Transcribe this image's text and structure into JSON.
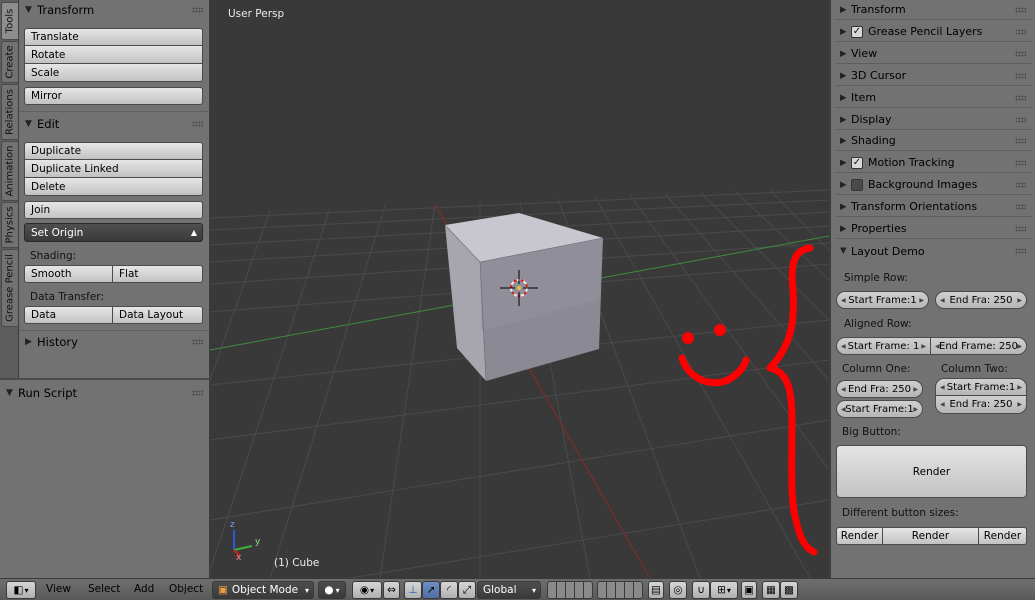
{
  "vertical_tabs": [
    "Tools",
    "Create",
    "Relations",
    "Animation",
    "Physics",
    "Grease Pencil"
  ],
  "toolshelf": {
    "transform": {
      "title": "Transform",
      "buttons": [
        "Translate",
        "Rotate",
        "Scale"
      ],
      "mirror": "Mirror"
    },
    "edit": {
      "title": "Edit",
      "buttons": [
        "Duplicate",
        "Duplicate Linked",
        "Delete"
      ],
      "join": "Join",
      "set_origin": "Set Origin",
      "shading_label": "Shading:",
      "shading": [
        "Smooth",
        "Flat"
      ],
      "data_transfer_label": "Data Transfer:",
      "data_transfer": [
        "Data",
        "Data Layout"
      ]
    },
    "history": {
      "title": "History"
    },
    "run_script": {
      "title": "Run Script"
    }
  },
  "viewport": {
    "view_name": "User Persp",
    "object_label": "(1) Cube",
    "axis_x": "x",
    "axis_y": "y",
    "axis_z": "z",
    "colors": {
      "background": "#393939",
      "grid": "#4a4a4a",
      "x_axis": "#8a2a2a",
      "y_axis": "#3f8a3f",
      "annotation": "#ff0000"
    }
  },
  "properties": {
    "panels": [
      {
        "title": "Transform",
        "checkbox": null
      },
      {
        "title": "Grease Pencil Layers",
        "checkbox": true
      },
      {
        "title": "View",
        "checkbox": null
      },
      {
        "title": "3D Cursor",
        "checkbox": null
      },
      {
        "title": "Item",
        "checkbox": null
      },
      {
        "title": "Display",
        "checkbox": null
      },
      {
        "title": "Shading",
        "checkbox": null
      },
      {
        "title": "Motion Tracking",
        "checkbox": true
      },
      {
        "title": "Background Images",
        "checkbox": false
      },
      {
        "title": "Transform Orientations",
        "checkbox": null
      },
      {
        "title": "Properties",
        "checkbox": null
      }
    ],
    "layout_demo": {
      "title": "Layout Demo",
      "simple_row_label": "Simple Row:",
      "simple_row": [
        "Start Frame:1",
        "End Fra:   250"
      ],
      "aligned_row_label": "Aligned Row:",
      "aligned_row": [
        "Start Frame:  1",
        "End Frame:  250"
      ],
      "column_one_label": "Column One:",
      "column_one": [
        "End Fra:   250",
        "Start Frame:1"
      ],
      "column_two_label": "Column Two:",
      "column_two": [
        "Start Frame:1",
        "End Fra:   250"
      ],
      "big_button_label": "Big Button:",
      "big_button": "Render",
      "sizes_label": "Different button sizes:",
      "sizes": [
        "Render",
        "Render",
        "Render"
      ]
    }
  },
  "header": {
    "menus": [
      "View",
      "Select",
      "Add",
      "Object"
    ],
    "mode": "Object Mode",
    "orientation": "Global"
  }
}
